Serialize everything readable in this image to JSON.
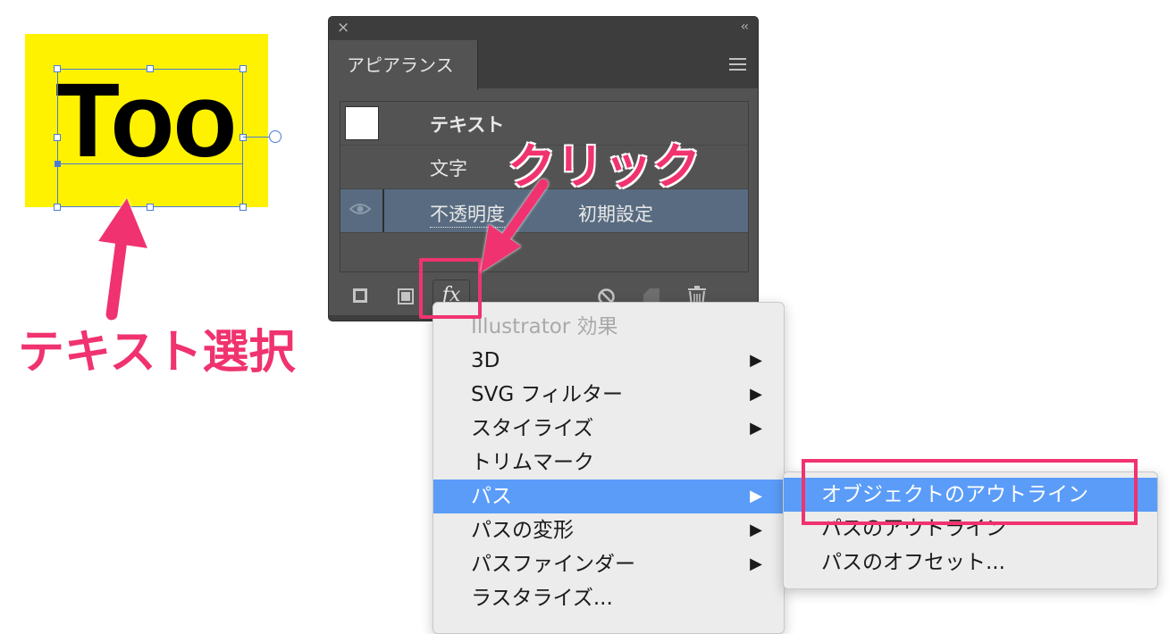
{
  "canvas": {
    "object_text": "Too",
    "colors": {
      "background": "#fff200",
      "selection": "#4b7bd8"
    }
  },
  "annotations": {
    "select_text": "テキスト選択",
    "click_text": "クリック",
    "color": "#f0336f"
  },
  "panel": {
    "close_icon": "×",
    "collapse_icon": "‹‹",
    "tab_label": "アピアランス",
    "rows": [
      {
        "label": "テキスト"
      },
      {
        "label": "文字"
      },
      {
        "label": "不透明度",
        "value": "初期設定",
        "selected": true
      }
    ],
    "bottom_tools": [
      "new-stroke-icon",
      "new-fill-icon",
      "fx-icon",
      "clear-icon",
      "duplicate-icon",
      "trash-icon"
    ],
    "fx_label": "fx"
  },
  "effect_menu": {
    "header": "Illustrator 効果",
    "items": [
      {
        "label": "3D",
        "submenu": true
      },
      {
        "label": "SVG フィルター",
        "submenu": true
      },
      {
        "label": "スタイライズ",
        "submenu": true
      },
      {
        "label": "トリムマーク",
        "submenu": false
      },
      {
        "label": "パス",
        "submenu": true,
        "active": true
      },
      {
        "label": "パスの変形",
        "submenu": true
      },
      {
        "label": "パスファインダー",
        "submenu": true
      },
      {
        "label": "ラスタライズ...",
        "submenu": false
      }
    ],
    "arrow_glyph": "▶"
  },
  "path_submenu": {
    "items": [
      {
        "label": "オブジェクトのアウトライン",
        "highlighted": true
      },
      {
        "label": "パスのアウトライン"
      },
      {
        "label": "パスのオフセット..."
      }
    ]
  }
}
